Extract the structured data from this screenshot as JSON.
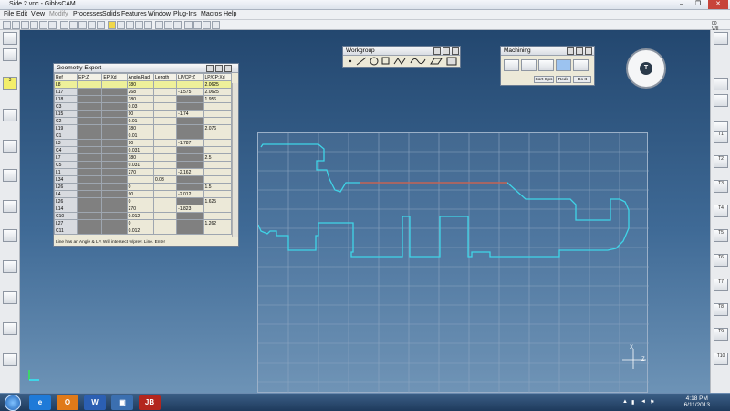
{
  "window": {
    "title": "Side 2.vnc - GibbsCAM",
    "buttons": {
      "minimize": "–",
      "restore": "❐",
      "close": "✕"
    }
  },
  "menu": {
    "items": [
      "File",
      "Edit",
      "View",
      "Modify",
      "Processes",
      "Solids",
      "Features",
      "Window",
      "Plug-Ins",
      "Macros",
      "Help"
    ]
  },
  "geometry_expert": {
    "title": "Geometry Expert",
    "columns": [
      "Ref",
      "EP:Z",
      "EP:Xd",
      "Angle/Rad",
      "Length",
      "LP/CP:Z",
      "LP/CP:Xd"
    ],
    "rows": [
      [
        "L8",
        "",
        "",
        "180",
        "",
        "",
        "2.0625"
      ],
      [
        "L17",
        "",
        "",
        "268",
        "",
        "-1.575",
        "2.0625"
      ],
      [
        "L18",
        "",
        "",
        "180",
        "",
        "",
        "1.956"
      ],
      [
        "C3",
        "",
        "",
        "0.03",
        "",
        "",
        ""
      ],
      [
        "L15",
        "",
        "",
        "90",
        "",
        "-1.74",
        ""
      ],
      [
        "C2",
        "",
        "",
        "0.01",
        "",
        "",
        ""
      ],
      [
        "L19",
        "",
        "",
        "180",
        "",
        "",
        "2.076"
      ],
      [
        "C1",
        "",
        "",
        "0.01",
        "",
        "",
        ""
      ],
      [
        "L3",
        "",
        "",
        "90",
        "",
        "-1.787",
        ""
      ],
      [
        "C4",
        "",
        "",
        "0.031",
        "",
        "",
        ""
      ],
      [
        "L7",
        "",
        "",
        "180",
        "",
        "",
        "2.5"
      ],
      [
        "C5",
        "",
        "",
        "0.031",
        "",
        "",
        ""
      ],
      [
        "L1",
        "",
        "",
        "270",
        "",
        "-2.162",
        ""
      ],
      [
        "L34",
        "",
        "",
        "",
        "0.03",
        "",
        ""
      ],
      [
        "L26",
        "",
        "",
        "0",
        "",
        "",
        "1.5"
      ],
      [
        "L4",
        "",
        "",
        "90",
        "",
        "-2.012",
        ""
      ],
      [
        "L26",
        "",
        "",
        "0",
        "",
        "",
        "1.625"
      ],
      [
        "L14",
        "",
        "",
        "270",
        "",
        "-1.823",
        ""
      ],
      [
        "C10",
        "",
        "",
        "0.012",
        "",
        "",
        ""
      ],
      [
        "L27",
        "",
        "",
        "0",
        "",
        "",
        "1.262"
      ],
      [
        "C11",
        "",
        "",
        "0.012",
        "",
        "",
        ""
      ]
    ],
    "status": "Line has an Angle & LP.  Will intersect w/prev. Line.  Enter"
  },
  "workgroup": {
    "title": "Workgroup"
  },
  "machining": {
    "title": "Machining",
    "buttons": {
      "sort": "Sort Ops",
      "redo": "Redo",
      "do_it": "Do It"
    }
  },
  "right_palette": {
    "readout_top": "00",
    "readout_bottom": "V/II",
    "tools": [
      "T1",
      "T2",
      "T3",
      "T4",
      "T5",
      "T6",
      "T7",
      "T8",
      "T9",
      "T10"
    ]
  },
  "dial": {
    "center": "T"
  },
  "canvas": {
    "axis_x_label": "X",
    "axis_z_label": "Z",
    "profile_color": "#3fd5e8",
    "selected_color": "#e0523a"
  },
  "taskbar": {
    "time": "4:18 PM",
    "date": "6/11/2013",
    "apps": [
      {
        "label": "e",
        "color": "#1e7ad8"
      },
      {
        "label": "O",
        "color": "#e07a19"
      },
      {
        "label": "W",
        "color": "#2b5fb3"
      },
      {
        "label": "▣",
        "color": "#3b6fb0"
      },
      {
        "label": "JB",
        "color": "#b3261e"
      }
    ]
  },
  "left_palette": {
    "highlighted": "3",
    "highlighted_label": "3"
  }
}
